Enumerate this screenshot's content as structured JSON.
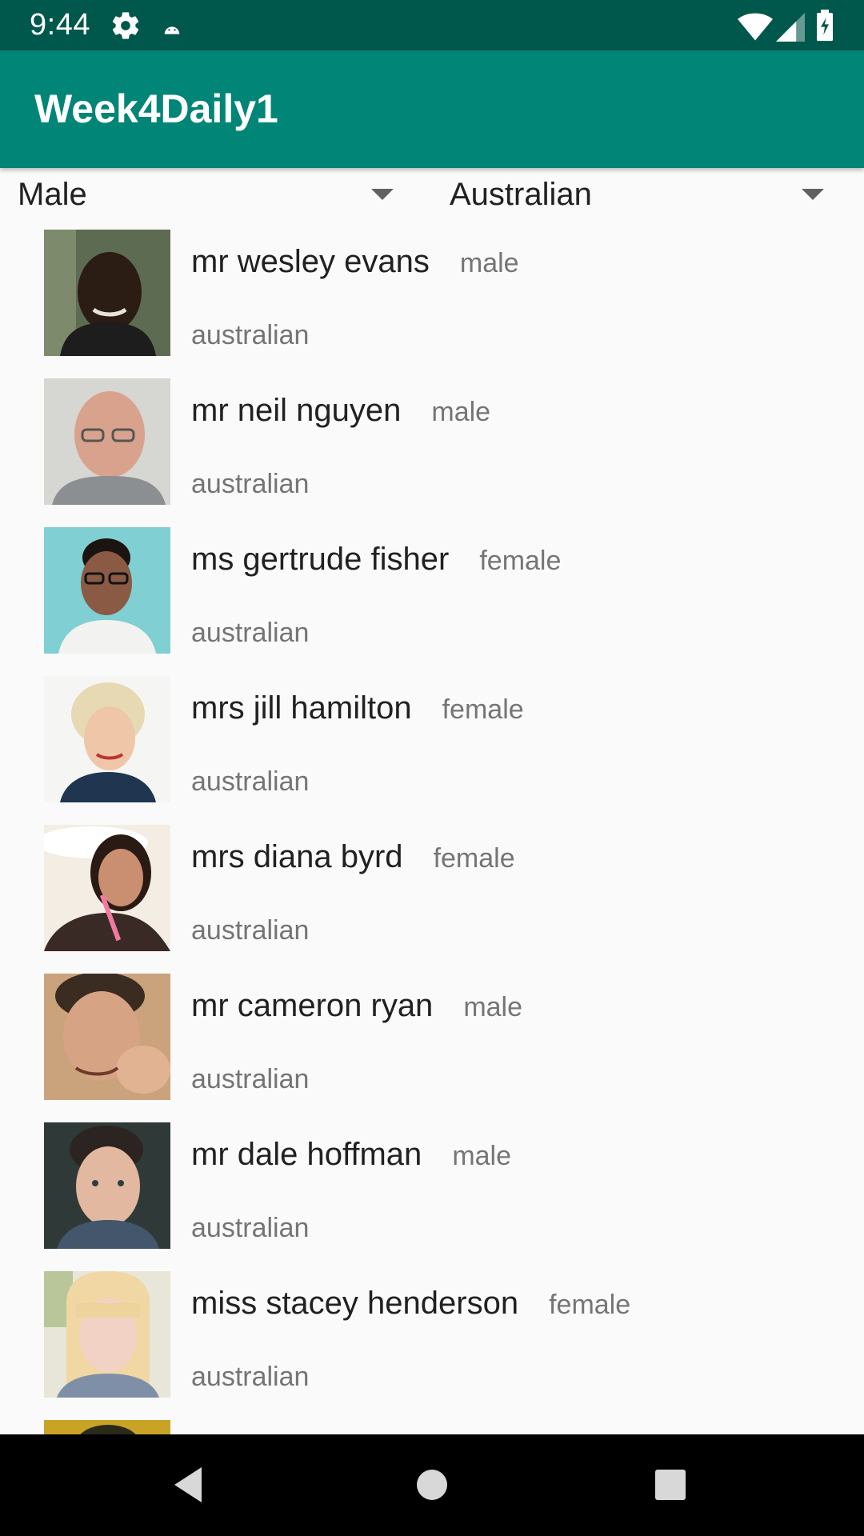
{
  "status_bar": {
    "time": "9:44",
    "icons": [
      "gear-icon",
      "android-debug-icon",
      "wifi-icon",
      "signal-icon",
      "battery-charging-icon"
    ]
  },
  "app_bar": {
    "title": "Week4Daily1"
  },
  "filters": {
    "gender_selected": "Male",
    "nationality_selected": "Australian"
  },
  "people": [
    {
      "name": "mr wesley evans",
      "gender": "male",
      "nationality": "australian"
    },
    {
      "name": "mr neil nguyen",
      "gender": "male",
      "nationality": "australian"
    },
    {
      "name": "ms gertrude fisher",
      "gender": "female",
      "nationality": "australian"
    },
    {
      "name": "mrs jill hamilton",
      "gender": "female",
      "nationality": "australian"
    },
    {
      "name": "mrs diana byrd",
      "gender": "female",
      "nationality": "australian"
    },
    {
      "name": "mr cameron ryan",
      "gender": "male",
      "nationality": "australian"
    },
    {
      "name": "mr dale hoffman",
      "gender": "male",
      "nationality": "australian"
    },
    {
      "name": "miss stacey henderson",
      "gender": "female",
      "nationality": "australian"
    },
    {
      "name": "",
      "gender": "",
      "nationality": ""
    }
  ],
  "nav_bar": {
    "icons": [
      "back-icon",
      "home-icon",
      "recents-icon"
    ]
  },
  "colors": {
    "status_bar": "#00574b",
    "app_bar": "#008577",
    "background": "#fafafa",
    "primary_text": "#212121",
    "secondary_text": "#757575"
  }
}
